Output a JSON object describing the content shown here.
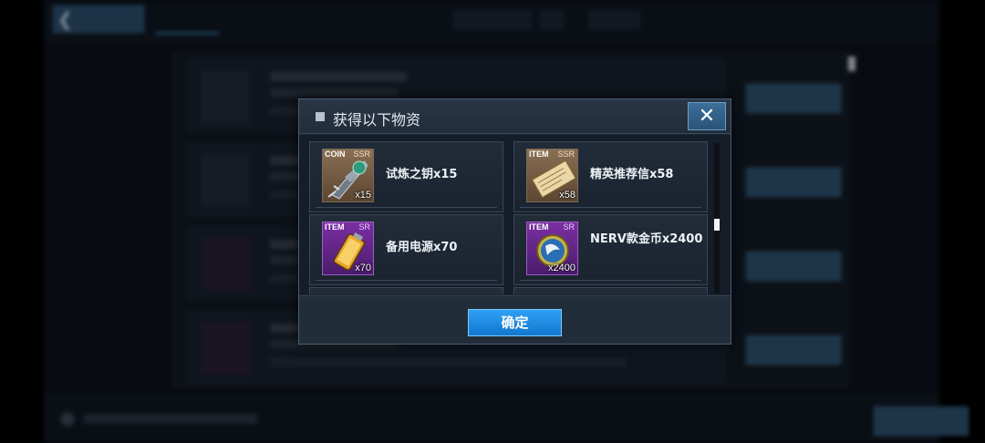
{
  "dialog": {
    "title": "获得以下物资",
    "close_label": "✕",
    "confirm_label": "确定"
  },
  "items": [
    {
      "type": "COIN",
      "rarity": "SSR",
      "quantity": "x15",
      "name": "试炼之钥x15",
      "icon": "key-icon"
    },
    {
      "type": "ITEM",
      "rarity": "SSR",
      "quantity": "x58",
      "name": "精英推荐信x58",
      "icon": "letter-icon"
    },
    {
      "type": "ITEM",
      "rarity": "SR",
      "quantity": "x70",
      "name": "备用电源x70",
      "icon": "battery-icon"
    },
    {
      "type": "ITEM",
      "rarity": "SR",
      "quantity": "x2400",
      "name": "NERV款金币x2400",
      "icon": "nerv-coin-icon"
    }
  ],
  "colors": {
    "ssr_frame": "#8a6f52",
    "sr_frame": "#7b2fa3",
    "confirm_button": "#2ea0f4",
    "close_button": "#3c6e98"
  }
}
